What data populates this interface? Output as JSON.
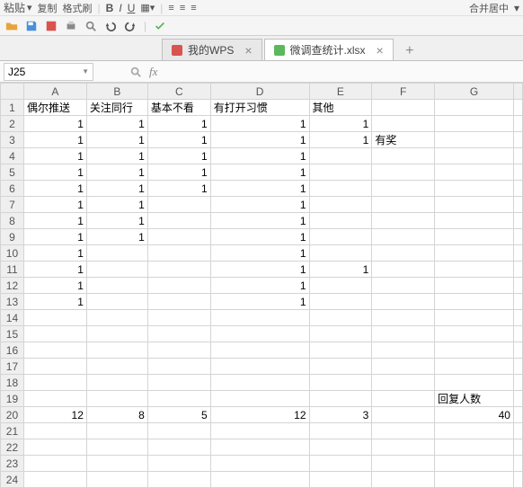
{
  "toolbar_top": {
    "paste_label": "粘贴",
    "copy_label": "复制",
    "format_painter_label": "格式刷",
    "merge_label": "合并居中"
  },
  "tabs": {
    "wps_label": "我的WPS",
    "file_label": "微调查统计.xlsx",
    "close_glyph": "×",
    "add_glyph": "+"
  },
  "formula_bar": {
    "cell_ref": "J25",
    "fx_label": "fx"
  },
  "columns": [
    "A",
    "B",
    "C",
    "D",
    "E",
    "F",
    "G"
  ],
  "row_numbers": [
    "1",
    "2",
    "3",
    "4",
    "5",
    "6",
    "7",
    "8",
    "9",
    "10",
    "11",
    "12",
    "13",
    "14",
    "15",
    "16",
    "17",
    "18",
    "19",
    "20",
    "21",
    "22",
    "23",
    "24"
  ],
  "headers": {
    "A": "偶尔推送",
    "B": "关注同行",
    "C": "基本不看",
    "D": "有打开习惯",
    "E": "其他",
    "G19": "回复人数"
  },
  "f3_label": "有奖",
  "data_rows": [
    {
      "A": "1",
      "B": "1",
      "C": "1",
      "D": "1",
      "E": "1"
    },
    {
      "A": "1",
      "B": "1",
      "C": "1",
      "D": "1",
      "E": "1"
    },
    {
      "A": "1",
      "B": "1",
      "C": "1",
      "D": "1"
    },
    {
      "A": "1",
      "B": "1",
      "C": "1",
      "D": "1"
    },
    {
      "A": "1",
      "B": "1",
      "C": "1",
      "D": "1"
    },
    {
      "A": "1",
      "B": "1",
      "D": "1"
    },
    {
      "A": "1",
      "B": "1",
      "D": "1"
    },
    {
      "A": "1",
      "B": "1",
      "D": "1"
    },
    {
      "A": "1",
      "D": "1"
    },
    {
      "A": "1",
      "D": "1",
      "E": "1"
    },
    {
      "A": "1",
      "D": "1"
    },
    {
      "A": "1",
      "D": "1"
    }
  ],
  "totals": {
    "A": "12",
    "B": "8",
    "C": "5",
    "D": "12",
    "E": "3",
    "G": "40"
  },
  "chart_data": {
    "type": "table",
    "title": "微调查统计",
    "categories": [
      "偶尔推送",
      "关注同行",
      "基本不看",
      "有打开习惯",
      "其他"
    ],
    "values": [
      12,
      8,
      5,
      12,
      3
    ],
    "annotations": {
      "回复人数": 40,
      "F3": "有奖"
    }
  }
}
